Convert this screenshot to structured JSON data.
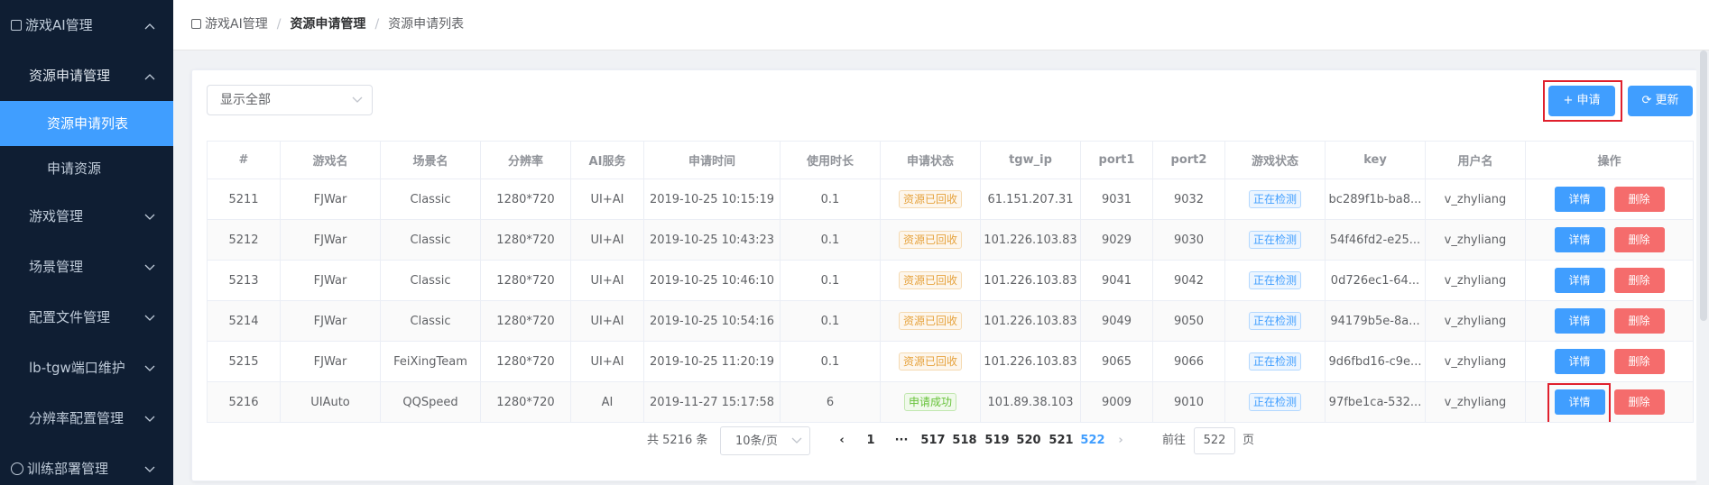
{
  "sidebar": {
    "top_item": "游戏AI管理",
    "group_open": "资源申请管理",
    "sub_items": [
      "资源申请列表",
      "申请资源"
    ],
    "items": [
      "游戏管理",
      "场景管理",
      "配置文件管理",
      "lb-tgw端口维护",
      "分辨率配置管理"
    ],
    "bottom_item": "训练部署管理"
  },
  "breadcrumb": [
    "游戏AI管理",
    "资源申请管理",
    "资源申请列表"
  ],
  "toolbar": {
    "filter_value": "显示全部",
    "apply_label": "+ 申请",
    "refresh_label": "更新"
  },
  "table": {
    "headers": [
      "#",
      "游戏名",
      "场景名",
      "分辨率",
      "AI服务",
      "申请时间",
      "使用时长",
      "申请状态",
      "tgw_ip",
      "port1",
      "port2",
      "游戏状态",
      "key",
      "用户名",
      "操作"
    ],
    "rows": [
      {
        "id": "5211",
        "game": "FJWar",
        "scene": "Classic",
        "res": "1280*720",
        "ai": "UI+AI",
        "time": "2019-10-25 10:15:19",
        "dur": "0.1",
        "status": "资源已回收",
        "ip": "61.151.207.31",
        "p1": "9031",
        "p2": "9032",
        "gstatus": "正在检测",
        "key": "bc289f1b-ba8...",
        "user": "v_zhyliang"
      },
      {
        "id": "5212",
        "game": "FJWar",
        "scene": "Classic",
        "res": "1280*720",
        "ai": "UI+AI",
        "time": "2019-10-25 10:43:23",
        "dur": "0.1",
        "status": "资源已回收",
        "ip": "101.226.103.83",
        "p1": "9029",
        "p2": "9030",
        "gstatus": "正在检测",
        "key": "54f46fd2-e25...",
        "user": "v_zhyliang"
      },
      {
        "id": "5213",
        "game": "FJWar",
        "scene": "Classic",
        "res": "1280*720",
        "ai": "UI+AI",
        "time": "2019-10-25 10:46:10",
        "dur": "0.1",
        "status": "资源已回收",
        "ip": "101.226.103.83",
        "p1": "9041",
        "p2": "9042",
        "gstatus": "正在检测",
        "key": "0d726ec1-64...",
        "user": "v_zhyliang"
      },
      {
        "id": "5214",
        "game": "FJWar",
        "scene": "Classic",
        "res": "1280*720",
        "ai": "UI+AI",
        "time": "2019-10-25 10:54:16",
        "dur": "0.1",
        "status": "资源已回收",
        "ip": "101.226.103.83",
        "p1": "9049",
        "p2": "9050",
        "gstatus": "正在检测",
        "key": "94179b5e-8a...",
        "user": "v_zhyliang"
      },
      {
        "id": "5215",
        "game": "FJWar",
        "scene": "FeiXingTeam",
        "res": "1280*720",
        "ai": "UI+AI",
        "time": "2019-10-25 11:20:19",
        "dur": "0.1",
        "status": "资源已回收",
        "ip": "101.226.103.83",
        "p1": "9065",
        "p2": "9066",
        "gstatus": "正在检测",
        "key": "9d6fbd16-c9e...",
        "user": "v_zhyliang"
      },
      {
        "id": "5216",
        "game": "UIAuto",
        "scene": "QQSpeed",
        "res": "1280*720",
        "ai": "AI",
        "time": "2019-11-27 15:17:58",
        "dur": "6",
        "status": "申请成功",
        "ip": "101.89.38.103",
        "p1": "9009",
        "p2": "9010",
        "gstatus": "正在检测",
        "key": "97fbe1ca-532...",
        "user": "v_zhyliang"
      }
    ],
    "detail_label": "详情",
    "delete_label": "删除"
  },
  "pagination": {
    "total": "共 5216 条",
    "page_size": "10条/页",
    "pages": [
      "1",
      "···",
      "517",
      "518",
      "519",
      "520",
      "521",
      "522"
    ],
    "current": "522",
    "goto_label": "前往",
    "goto_value": "522",
    "page_suffix": "页"
  },
  "colors": {
    "primary": "#409eff",
    "danger": "#f56c6c",
    "sidebar_bg": "#0f1e33",
    "highlight": "#e0202d"
  }
}
